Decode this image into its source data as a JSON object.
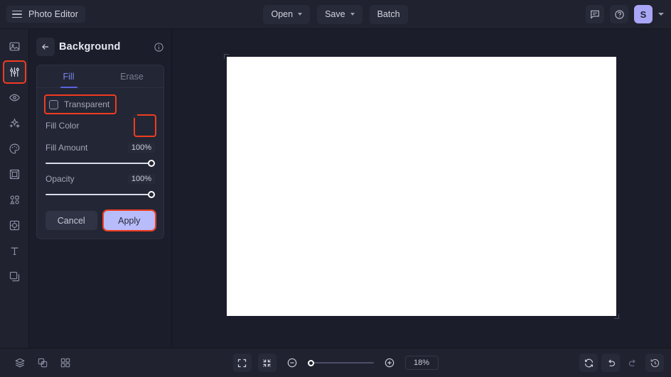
{
  "app": {
    "title": "Photo Editor",
    "menu_icon": "hamburger-icon"
  },
  "topbar": {
    "open_label": "Open",
    "save_label": "Save",
    "batch_label": "Batch",
    "feedback_icon": "comment-icon",
    "help_icon": "help-circle-icon",
    "avatar_initial": "S",
    "avatar_color": "#a9a6f7"
  },
  "rail": {
    "items": [
      {
        "name": "image",
        "icon": "image-icon",
        "selected": false
      },
      {
        "name": "adjustments",
        "icon": "sliders-icon",
        "selected": true
      },
      {
        "name": "retouch",
        "icon": "eye-icon",
        "selected": false
      },
      {
        "name": "effects",
        "icon": "sparkles-icon",
        "selected": false
      },
      {
        "name": "color",
        "icon": "palette-icon",
        "selected": false
      },
      {
        "name": "frame",
        "icon": "frame-icon",
        "selected": false
      },
      {
        "name": "shapes",
        "icon": "shapes-icon",
        "selected": false
      },
      {
        "name": "focus",
        "icon": "focus-icon",
        "selected": false
      },
      {
        "name": "text",
        "icon": "text-icon",
        "selected": false
      },
      {
        "name": "layers",
        "icon": "layers-icon",
        "selected": false
      }
    ],
    "highlight_color": "#f03c20"
  },
  "panel": {
    "back_icon": "arrow-left-icon",
    "title": "Background",
    "info_icon": "info-circle-icon",
    "tabs": [
      {
        "label": "Fill",
        "active": true
      },
      {
        "label": "Erase",
        "active": false
      }
    ],
    "transparent": {
      "label": "Transparent",
      "checked": false,
      "highlighted": true
    },
    "fill_color": {
      "label": "Fill Color",
      "value": "#ffffff",
      "highlighted": true
    },
    "fill_amount": {
      "label": "Fill Amount",
      "value": "100%",
      "percent": 100
    },
    "opacity": {
      "label": "Opacity",
      "value": "100%",
      "percent": 100
    },
    "cancel_label": "Cancel",
    "apply_label": "Apply",
    "apply_highlighted": true,
    "accent_color": "#7c84ec"
  },
  "canvas": {
    "background_color": "#ffffff"
  },
  "bottombar": {
    "left_icons": [
      {
        "name": "layers-panel",
        "icon": "layers-stack-icon"
      },
      {
        "name": "compare",
        "icon": "compare-squares-icon"
      },
      {
        "name": "grid",
        "icon": "grid-four-icon"
      }
    ],
    "fit_screen_icon": "expand-corners-icon",
    "shrink_icon": "collapse-arrows-icon",
    "zoom_out_icon": "minus-circle-icon",
    "zoom_in_icon": "plus-circle-icon",
    "zoom_level": "18%",
    "zoom_slider_percent": 0,
    "right_icons": [
      {
        "name": "reset",
        "icon": "refresh-icon",
        "enabled": true
      },
      {
        "name": "undo",
        "icon": "undo-arrow-icon",
        "enabled": true
      },
      {
        "name": "redo",
        "icon": "redo-arrow-icon",
        "enabled": false
      },
      {
        "name": "history",
        "icon": "history-clock-icon",
        "enabled": true
      }
    ]
  }
}
